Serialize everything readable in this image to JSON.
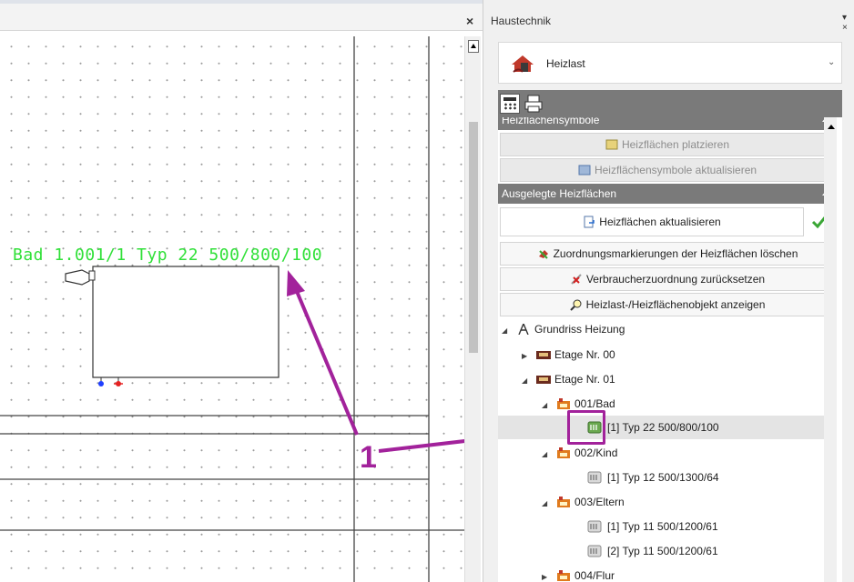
{
  "cad": {
    "close_label": "×",
    "room_label": "Bad 1.001/1 Typ 22 500/800/100",
    "callout_number": "1"
  },
  "panel": {
    "title": "Haustechnik",
    "pin_label": "▾ ×",
    "dropdown": {
      "icon": "heating-load-icon",
      "value": "Heizlast"
    },
    "tabs": [
      {
        "icon": "calculator-icon"
      },
      {
        "icon": "printer-icon"
      }
    ],
    "section_symbols": {
      "title": "Heizflächensymbole",
      "buttons": [
        {
          "label": "Heizflächen platzieren",
          "icon": "radiator-place-icon"
        },
        {
          "label": "Heizflächensymbole aktualisieren",
          "icon": "radiator-refresh-icon"
        }
      ]
    },
    "section_laid_out": {
      "title": "Ausgelegte Heizflächen",
      "update_button": "Heizflächen aktualisieren",
      "buttons": [
        {
          "label": "Zuordnungsmarkierungen der Heizflächen löschen",
          "icon": "eraser-icon"
        },
        {
          "label": "Verbraucherzuordnung zurücksetzen",
          "icon": "unlink-icon"
        },
        {
          "label": "Heizlast-/Heizflächenobjekt anzeigen",
          "icon": "magnifier-icon"
        }
      ]
    },
    "tree": [
      {
        "label": "Grundriss Heizung",
        "expander": "◢",
        "icon": "compass-icon"
      },
      {
        "label": "Etage Nr. 00",
        "expander": "▶",
        "icon": "floor-icon"
      },
      {
        "label": "Etage Nr. 01",
        "expander": "◢",
        "icon": "floor-icon"
      },
      {
        "label": "001/Bad",
        "expander": "◢",
        "icon": "room-icon"
      },
      {
        "label": "[1] Typ 22 500/800/100",
        "icon": "radiator-assigned-icon",
        "selected": true
      },
      {
        "label": "002/Kind",
        "expander": "◢",
        "icon": "room-icon"
      },
      {
        "label": "[1] Typ 12 500/1300/64",
        "icon": "radiator-icon"
      },
      {
        "label": "003/Eltern",
        "expander": "◢",
        "icon": "room-icon"
      },
      {
        "label": "[1] Typ 11 500/1200/61",
        "icon": "radiator-icon"
      },
      {
        "label": "[2] Typ 11 500/1200/61",
        "icon": "radiator-icon"
      },
      {
        "label": "004/Flur",
        "expander": "▶",
        "icon": "room-icon"
      }
    ],
    "colors": {
      "accent_callout": "#a2229b",
      "label_green": "#31e039",
      "section_header": "#7a7a7a"
    }
  }
}
